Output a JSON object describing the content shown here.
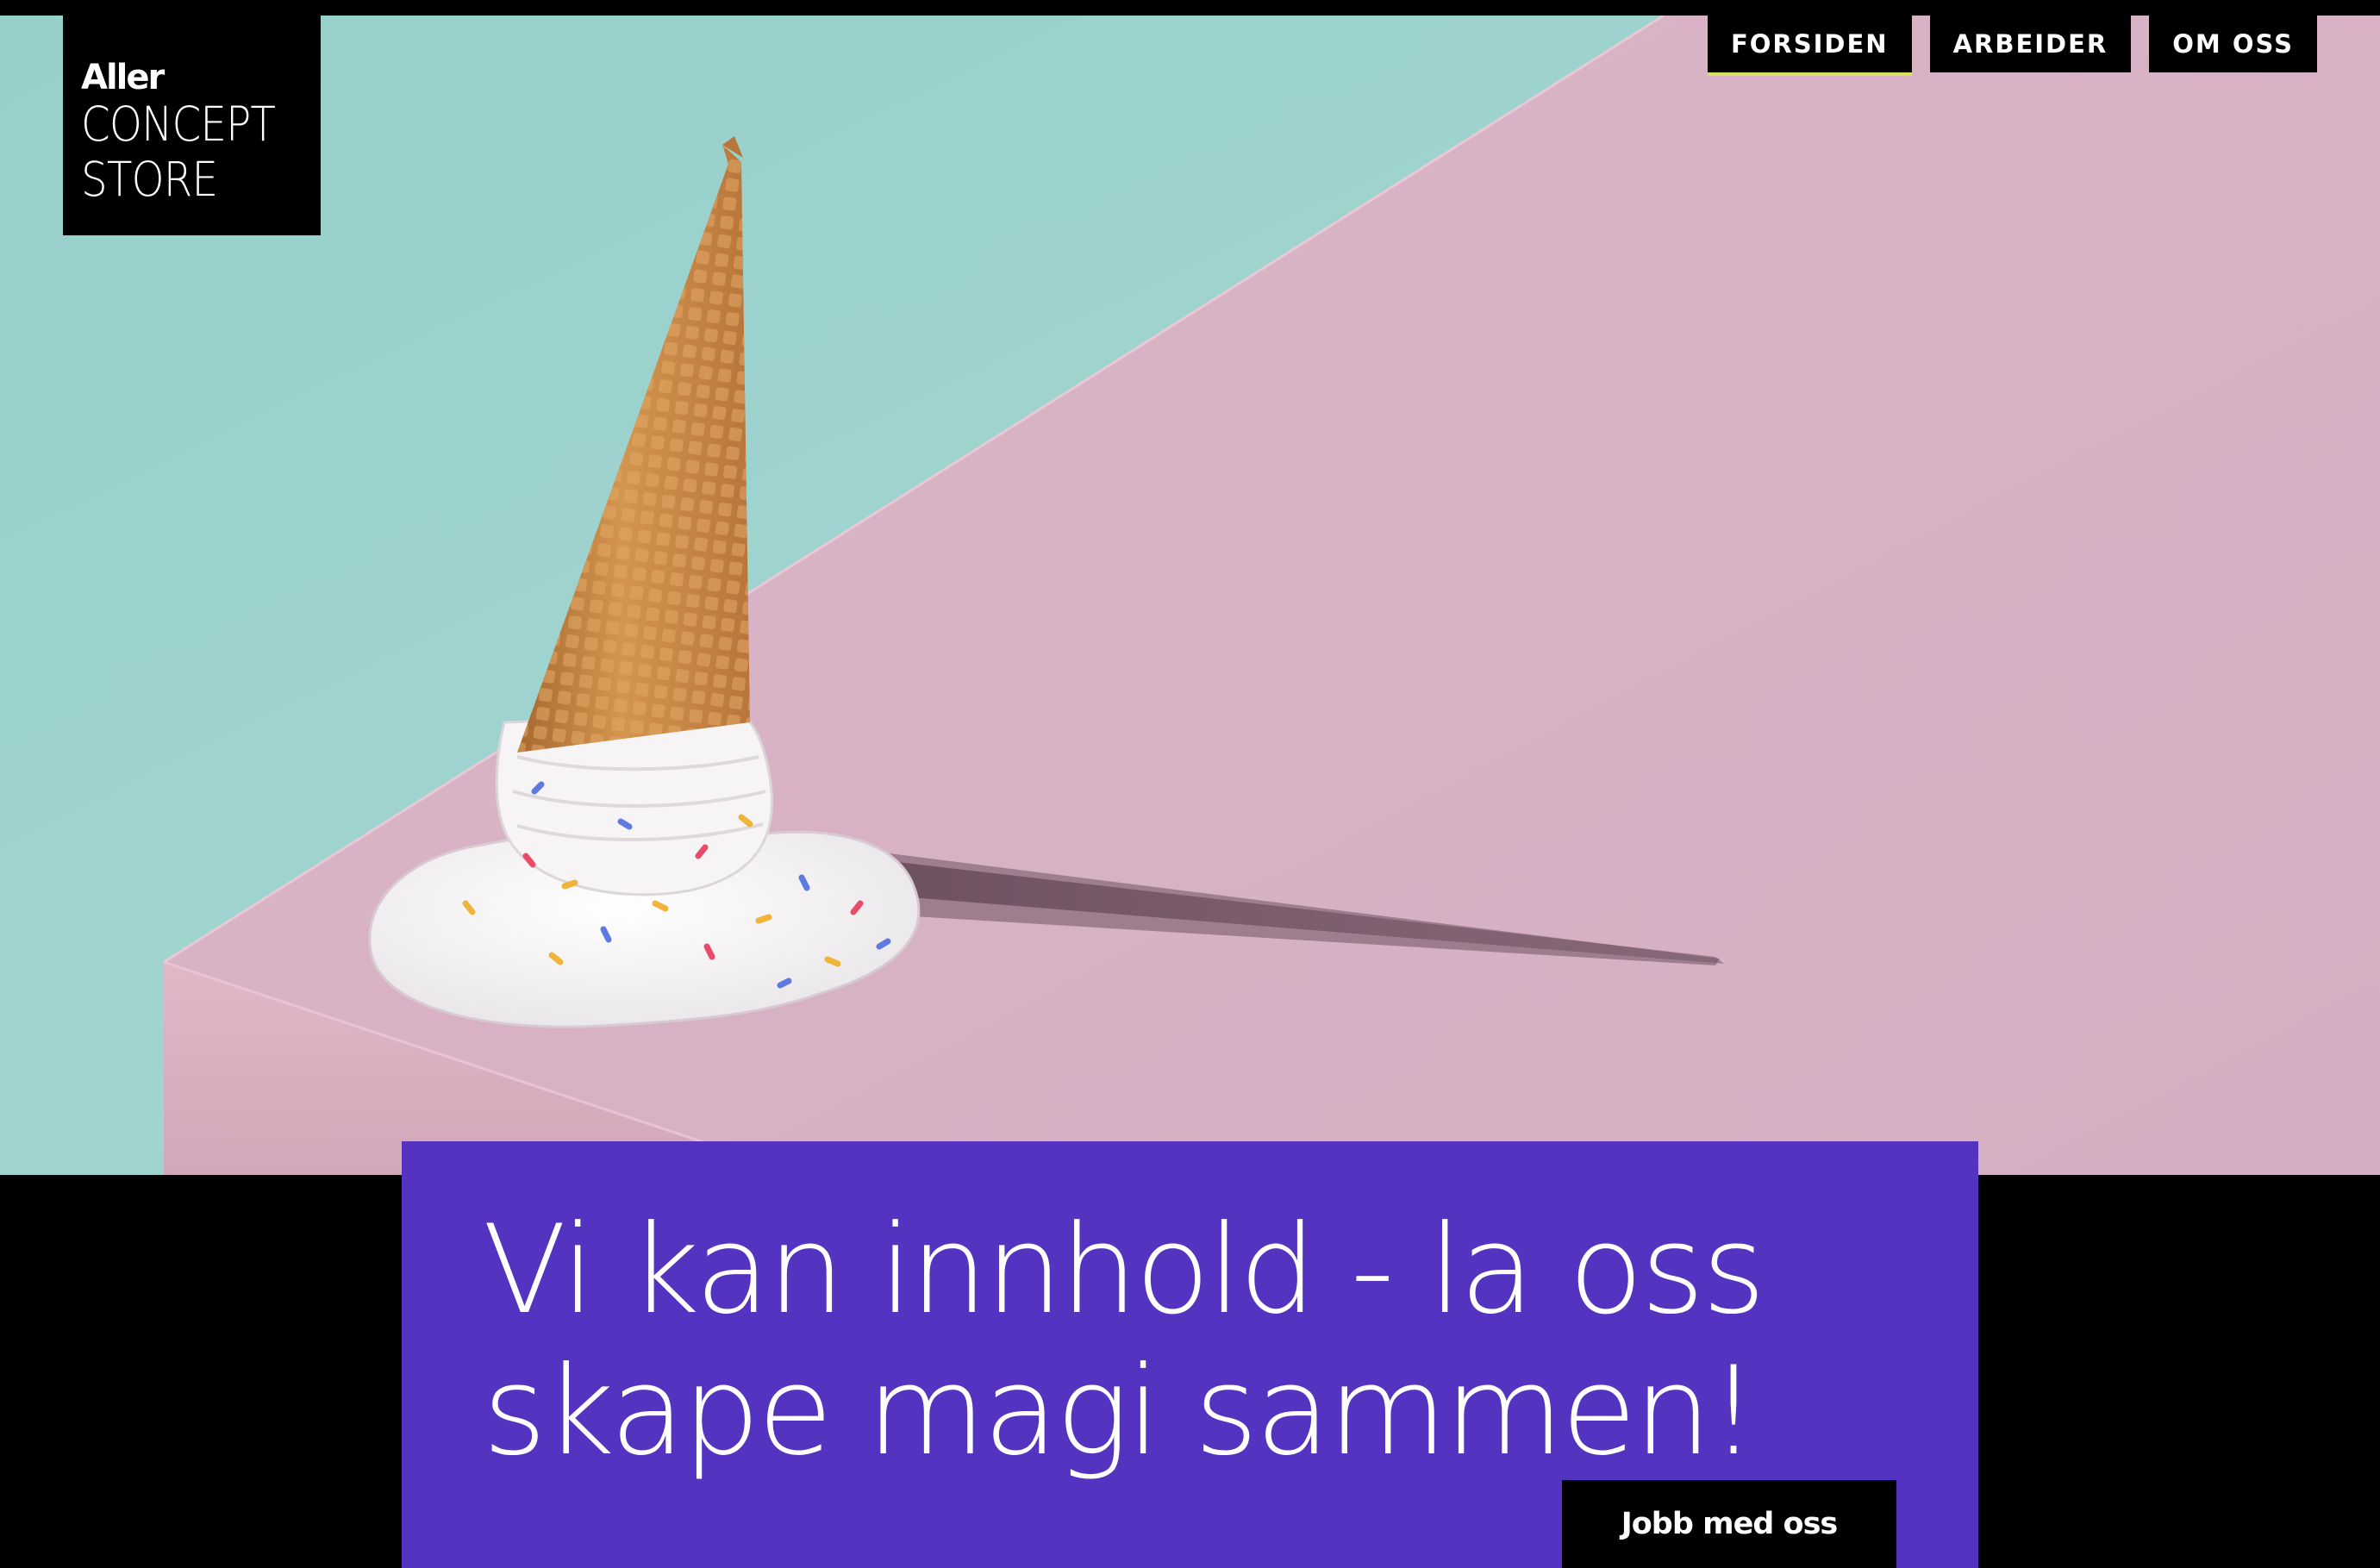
{
  "brand": {
    "name": "Aller",
    "line1": "CONCEPT",
    "line2": "STORE"
  },
  "nav": {
    "items": [
      {
        "label": "FORSIDEN",
        "active": true
      },
      {
        "label": "ARBEIDER",
        "active": false
      },
      {
        "label": "OM OSS",
        "active": false
      }
    ],
    "active_underline_color": "#d4e157"
  },
  "hero": {
    "image": "fallen-ice-cream-cone-on-pink-block",
    "colors": {
      "mint": "#9fd3cf",
      "pink": "#d8b4c6",
      "cone": "#c9894a",
      "ice_cream": "#f4f2f0"
    }
  },
  "card": {
    "background": "#5433c1",
    "headline_line1": "Vi kan innhold - la oss",
    "headline_line2": "skape magi sammen!",
    "cta_label": "Jobb med oss"
  }
}
